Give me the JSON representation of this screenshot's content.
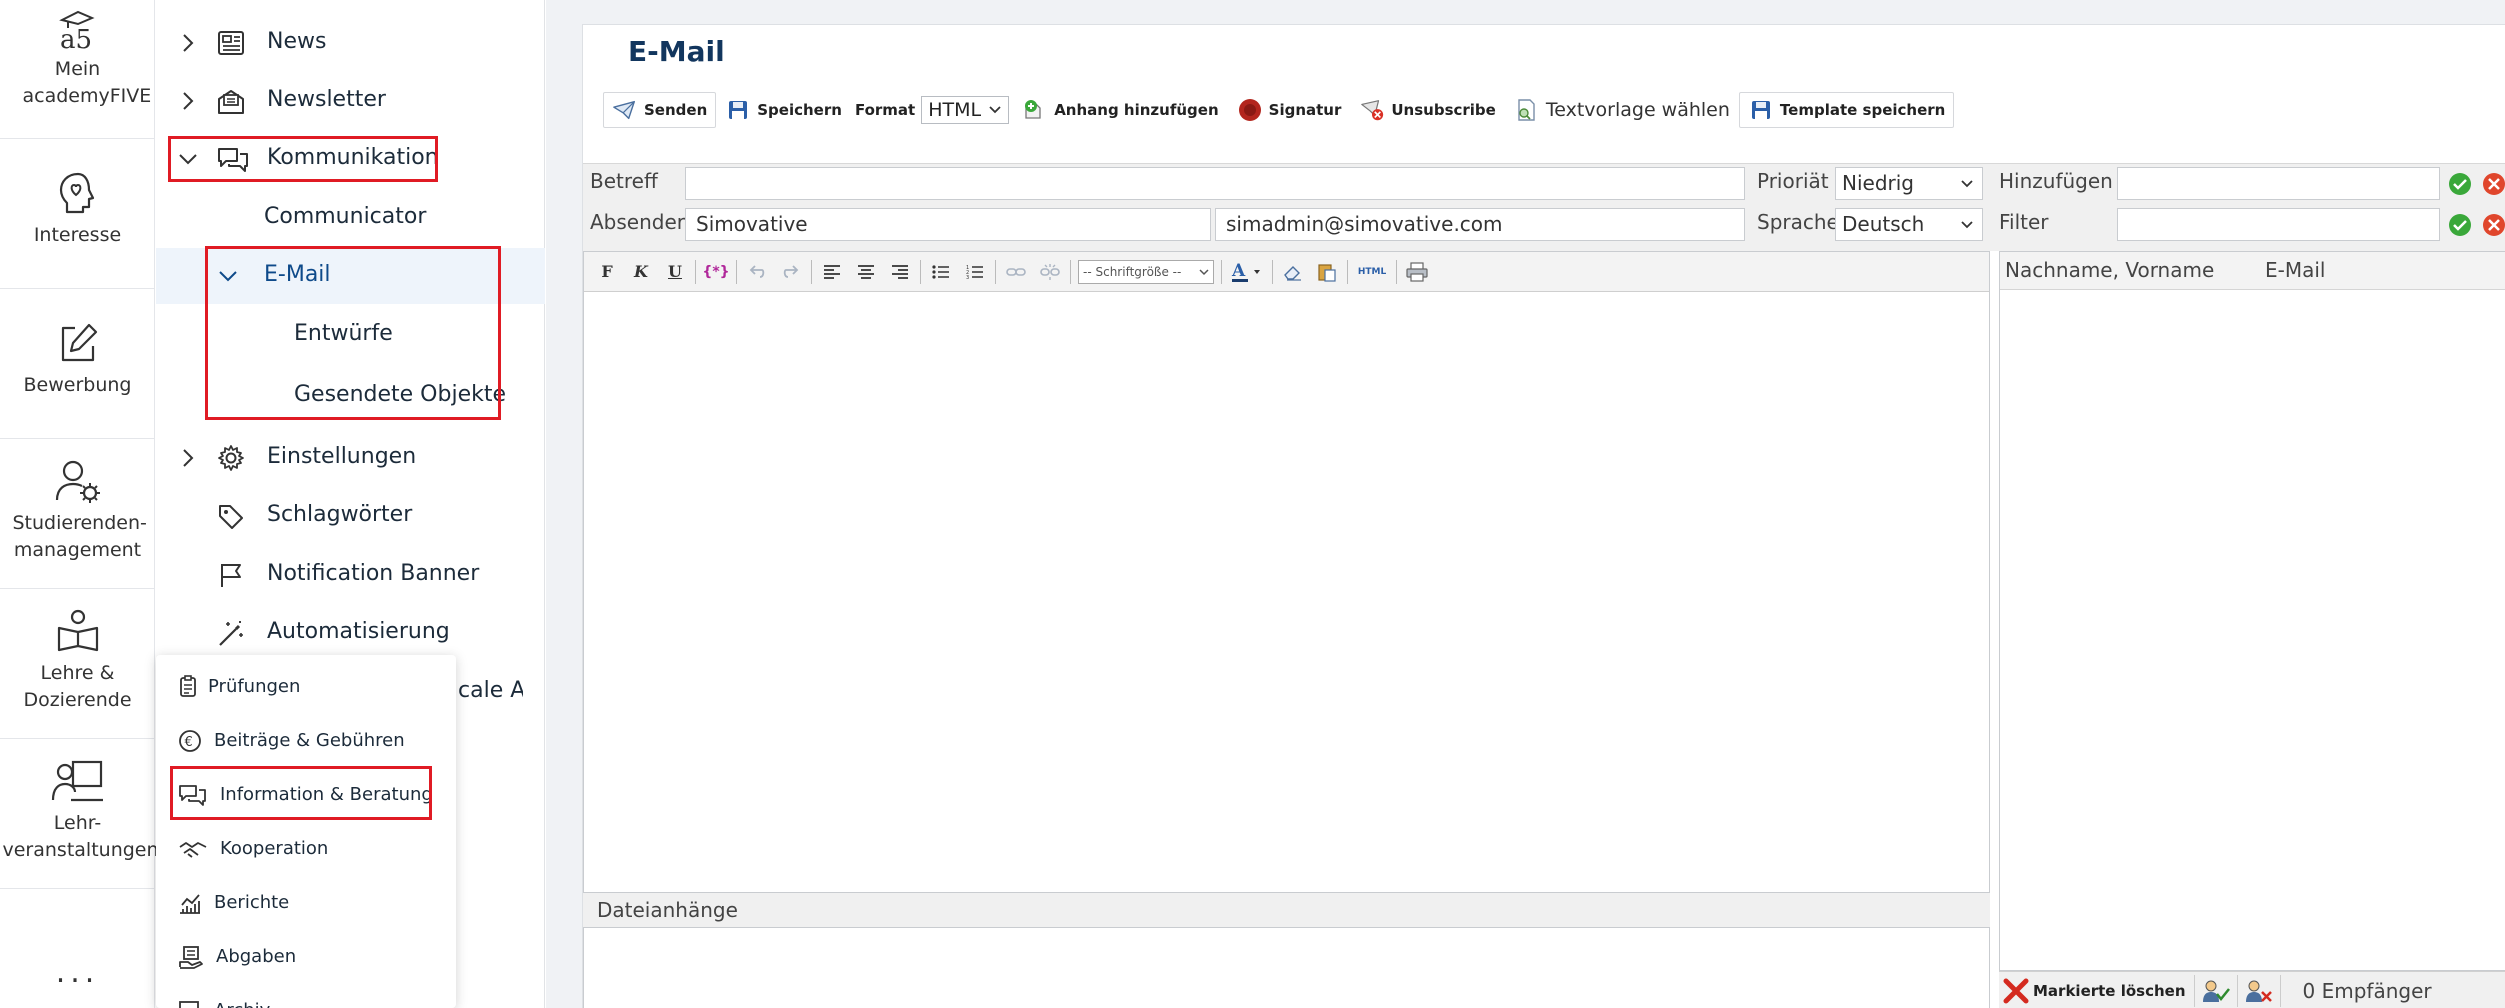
{
  "rail": {
    "items": [
      {
        "label": "Mein academyFIVE",
        "icon": "academyfive-logo-icon"
      },
      {
        "label": "Interesse",
        "icon": "head-heart-icon"
      },
      {
        "label": "Bewerbung",
        "icon": "edit-icon"
      },
      {
        "label": "Studierenden-management",
        "icon": "user-gear-icon"
      },
      {
        "label": "Lehre & Dozierende",
        "icon": "book-user-icon"
      },
      {
        "label": "Lehr-veranstaltungen",
        "icon": "presenter-icon"
      }
    ],
    "more": "..."
  },
  "nav": {
    "items": {
      "news": "News",
      "newsletter": "Newsletter",
      "kommunikation": "Kommunikation",
      "communicator": "Communicator",
      "email": "E-Mail",
      "entwuerfe": "Entwürfe",
      "gesendete": "Gesendete Objekte",
      "einstellungen": "Einstellungen",
      "schlagwoerter": "Schlagwörter",
      "notification": "Notification Banner",
      "automatisierung": "Automatisierung"
    },
    "tail": "cale Au"
  },
  "popup": {
    "items": [
      "Prüfungen",
      "Beiträge & Gebühren",
      "Information & Beratung",
      "Kooperation",
      "Berichte",
      "Abgaben",
      "Archiv"
    ]
  },
  "main": {
    "title": "E-Mail",
    "toolbar": {
      "send": "Senden",
      "save": "Speichern",
      "format_label": "Format",
      "format_value": "HTML",
      "attach": "Anhang hinzufügen",
      "signature": "Signatur",
      "unsubscribe": "Unsubscribe",
      "template_choose": "Textvorlage wählen",
      "template_save": "Template speichern"
    },
    "form": {
      "betreff_label": "Betreff",
      "betreff_value": "",
      "absender_label": "Absender",
      "absender_name": "Simovative",
      "absender_email": "simadmin@simovative.com",
      "prioritaet_label": "Prioriät",
      "prioritaet_value": "Niedrig",
      "sprache_label": "Sprache",
      "sprache_value": "Deutsch",
      "hinzufuegen_label": "Hinzufügen",
      "filter_label": "Filter"
    },
    "editor": {
      "font_size_placeholder": "-- Schriftgröße --",
      "html_label": "HTML"
    },
    "attachments_label": "Dateianhänge",
    "recipients": {
      "col_name": "Nachname, Vorname",
      "col_email": "E-Mail",
      "delete_marked": "Markierte löschen",
      "count": "0 Empfänger"
    }
  }
}
